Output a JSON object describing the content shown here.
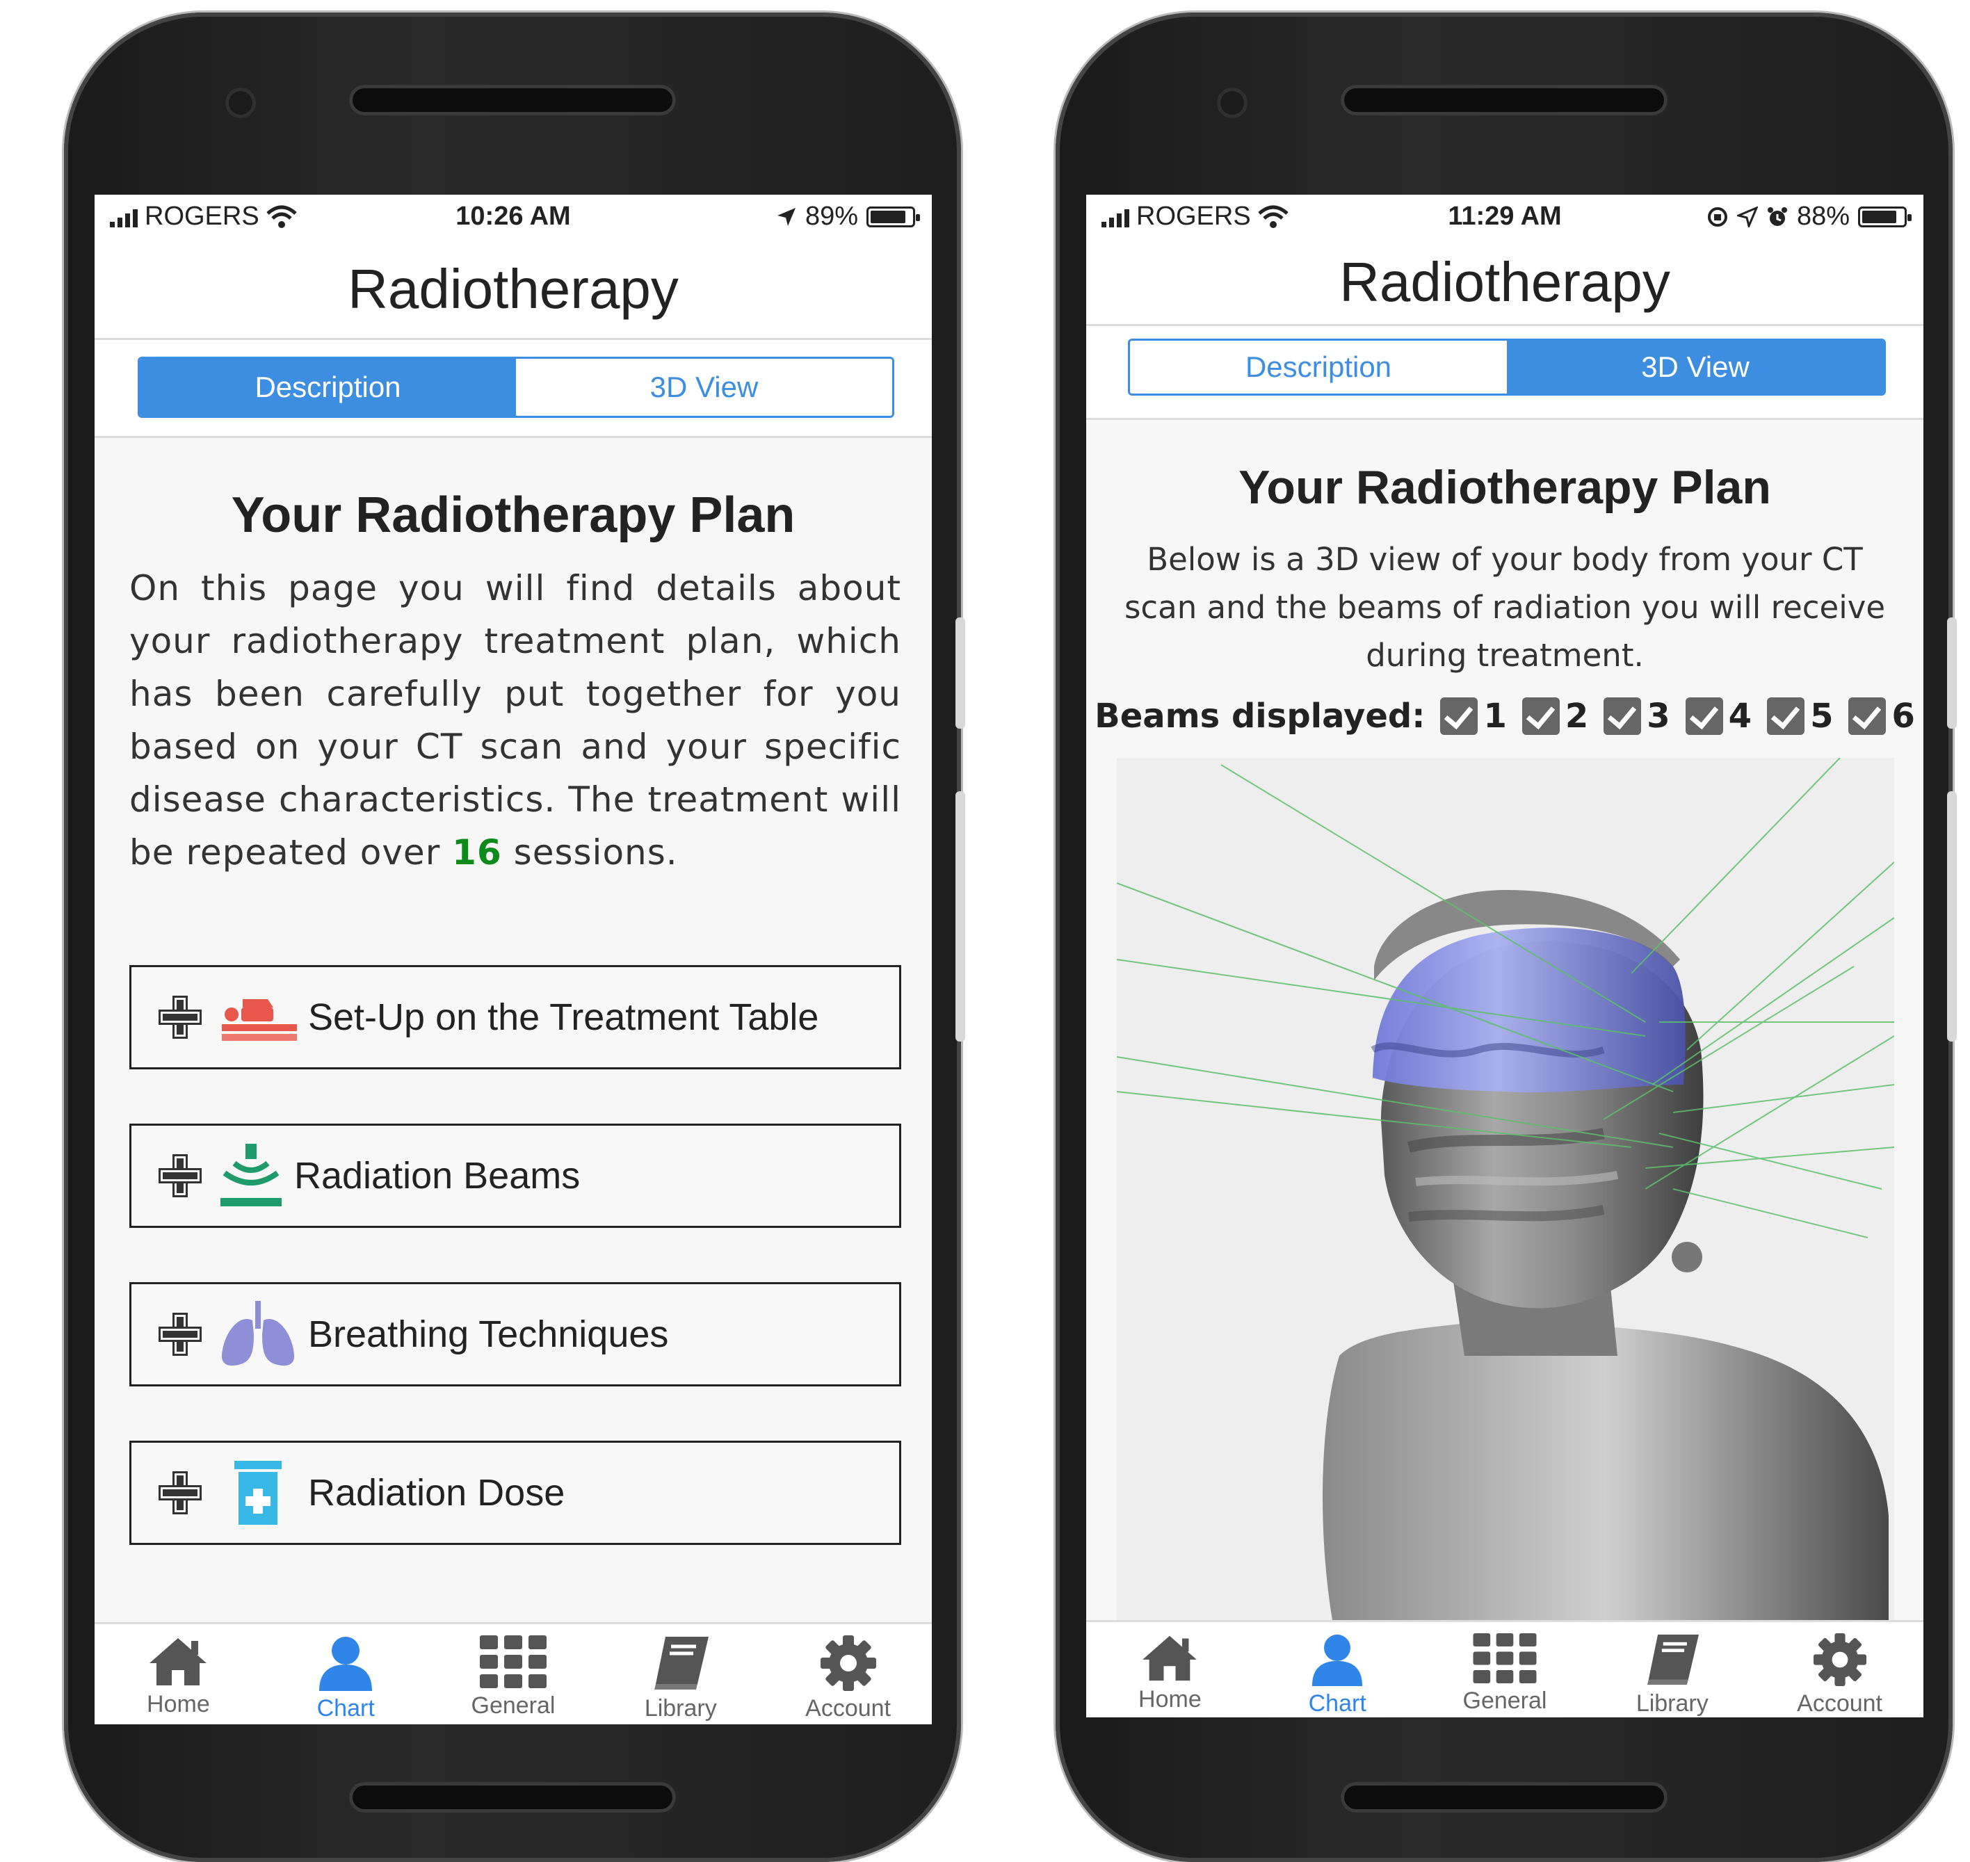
{
  "screens": [
    {
      "status": {
        "carrier": "ROGERS",
        "time": "10:26 AM",
        "battery": "89%",
        "battery_level": 0.89
      },
      "title": "Radiotherapy",
      "segments": {
        "description": "Description",
        "view3d": "3D View",
        "active": "description"
      },
      "plan_title": "Your Radiotherapy Plan",
      "intro": {
        "before": "On this page you will find details about your radiotherapy treatment plan, which has been carefully put together for you based on your CT scan and your specific disease characteristics. The treatment will be repeated over ",
        "sessions": "16",
        "after": " sessions."
      },
      "sections": [
        {
          "label": "Set-Up on the Treatment Table",
          "icon": "treatment-table-icon",
          "color": "#e8574b"
        },
        {
          "label": "Radiation Beams",
          "icon": "radiation-beams-icon",
          "color": "#1f9a6b"
        },
        {
          "label": "Breathing Techniques",
          "icon": "lungs-icon",
          "color": "#8f8fd8"
        },
        {
          "label": "Radiation Dose",
          "icon": "dose-bottle-icon",
          "color": "#37b8e6"
        }
      ],
      "tabs": [
        {
          "label": "Home",
          "icon": "home-icon"
        },
        {
          "label": "Chart",
          "icon": "person-icon",
          "active": true
        },
        {
          "label": "General",
          "icon": "grid-icon"
        },
        {
          "label": "Library",
          "icon": "book-icon"
        },
        {
          "label": "Account",
          "icon": "gear-icon"
        }
      ]
    },
    {
      "status": {
        "carrier": "ROGERS",
        "time": "11:29 AM",
        "battery": "88%",
        "battery_level": 0.88
      },
      "title": "Radiotherapy",
      "segments": {
        "description": "Description",
        "view3d": "3D View",
        "active": "view3d"
      },
      "plan_title": "Your Radiotherapy Plan",
      "intro": "Below is a 3D view of your body from your CT scan and the beams of radiation you will receive during treatment.",
      "beams_label": "Beams displayed:",
      "beams": [
        "1",
        "2",
        "3",
        "4",
        "5",
        "6"
      ],
      "tabs": [
        {
          "label": "Home",
          "icon": "home-icon"
        },
        {
          "label": "Chart",
          "icon": "person-icon",
          "active": true
        },
        {
          "label": "General",
          "icon": "grid-icon"
        },
        {
          "label": "Library",
          "icon": "book-icon"
        },
        {
          "label": "Account",
          "icon": "gear-icon"
        }
      ]
    }
  ],
  "colors": {
    "accent": "#3d8ee0",
    "highlight": "#0e8a1a",
    "beam": "#5cc06a",
    "tumor": "#8d96e8"
  }
}
